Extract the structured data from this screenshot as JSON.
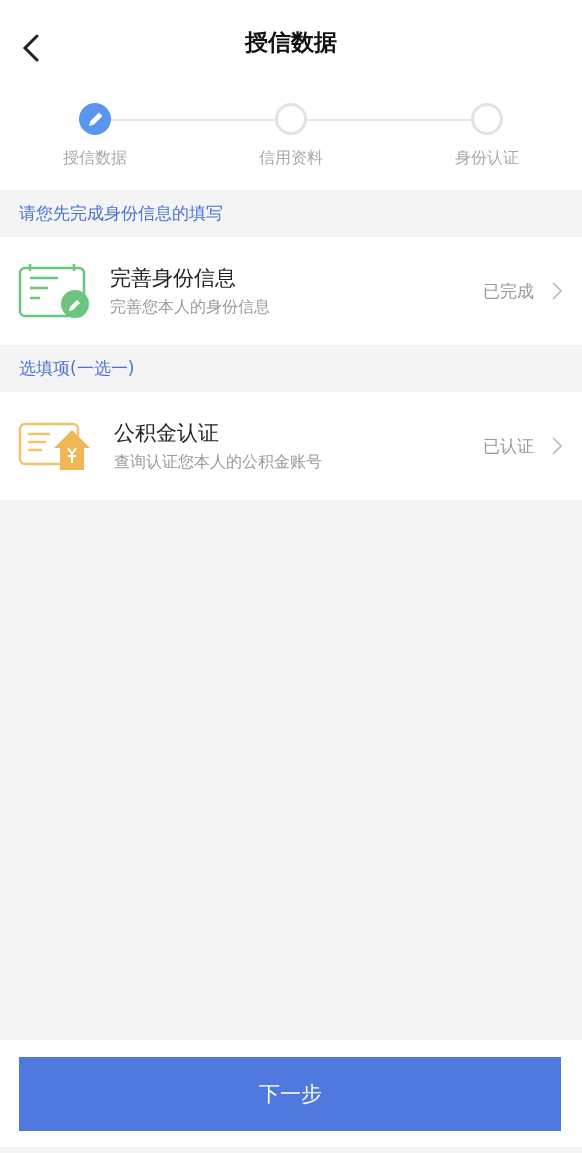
{
  "header": {
    "title": "授信数据"
  },
  "steps": [
    {
      "label": "授信数据",
      "selected": true
    },
    {
      "label": "信用资料",
      "selected": false
    },
    {
      "label": "身份认证",
      "selected": false
    }
  ],
  "sections": [
    {
      "heading": "请您先完成身份信息的填写",
      "items": [
        {
          "kind": "identity",
          "title": "完善身份信息",
          "subtitle": "完善您本人的身份信息",
          "status": "已完成"
        }
      ]
    },
    {
      "heading": "选填项(一选一)",
      "items": [
        {
          "kind": "fund",
          "title": "公积金认证",
          "subtitle": "查询认证您本人的公积金账号",
          "status": "已认证"
        }
      ]
    }
  ],
  "next_button": "下一步"
}
